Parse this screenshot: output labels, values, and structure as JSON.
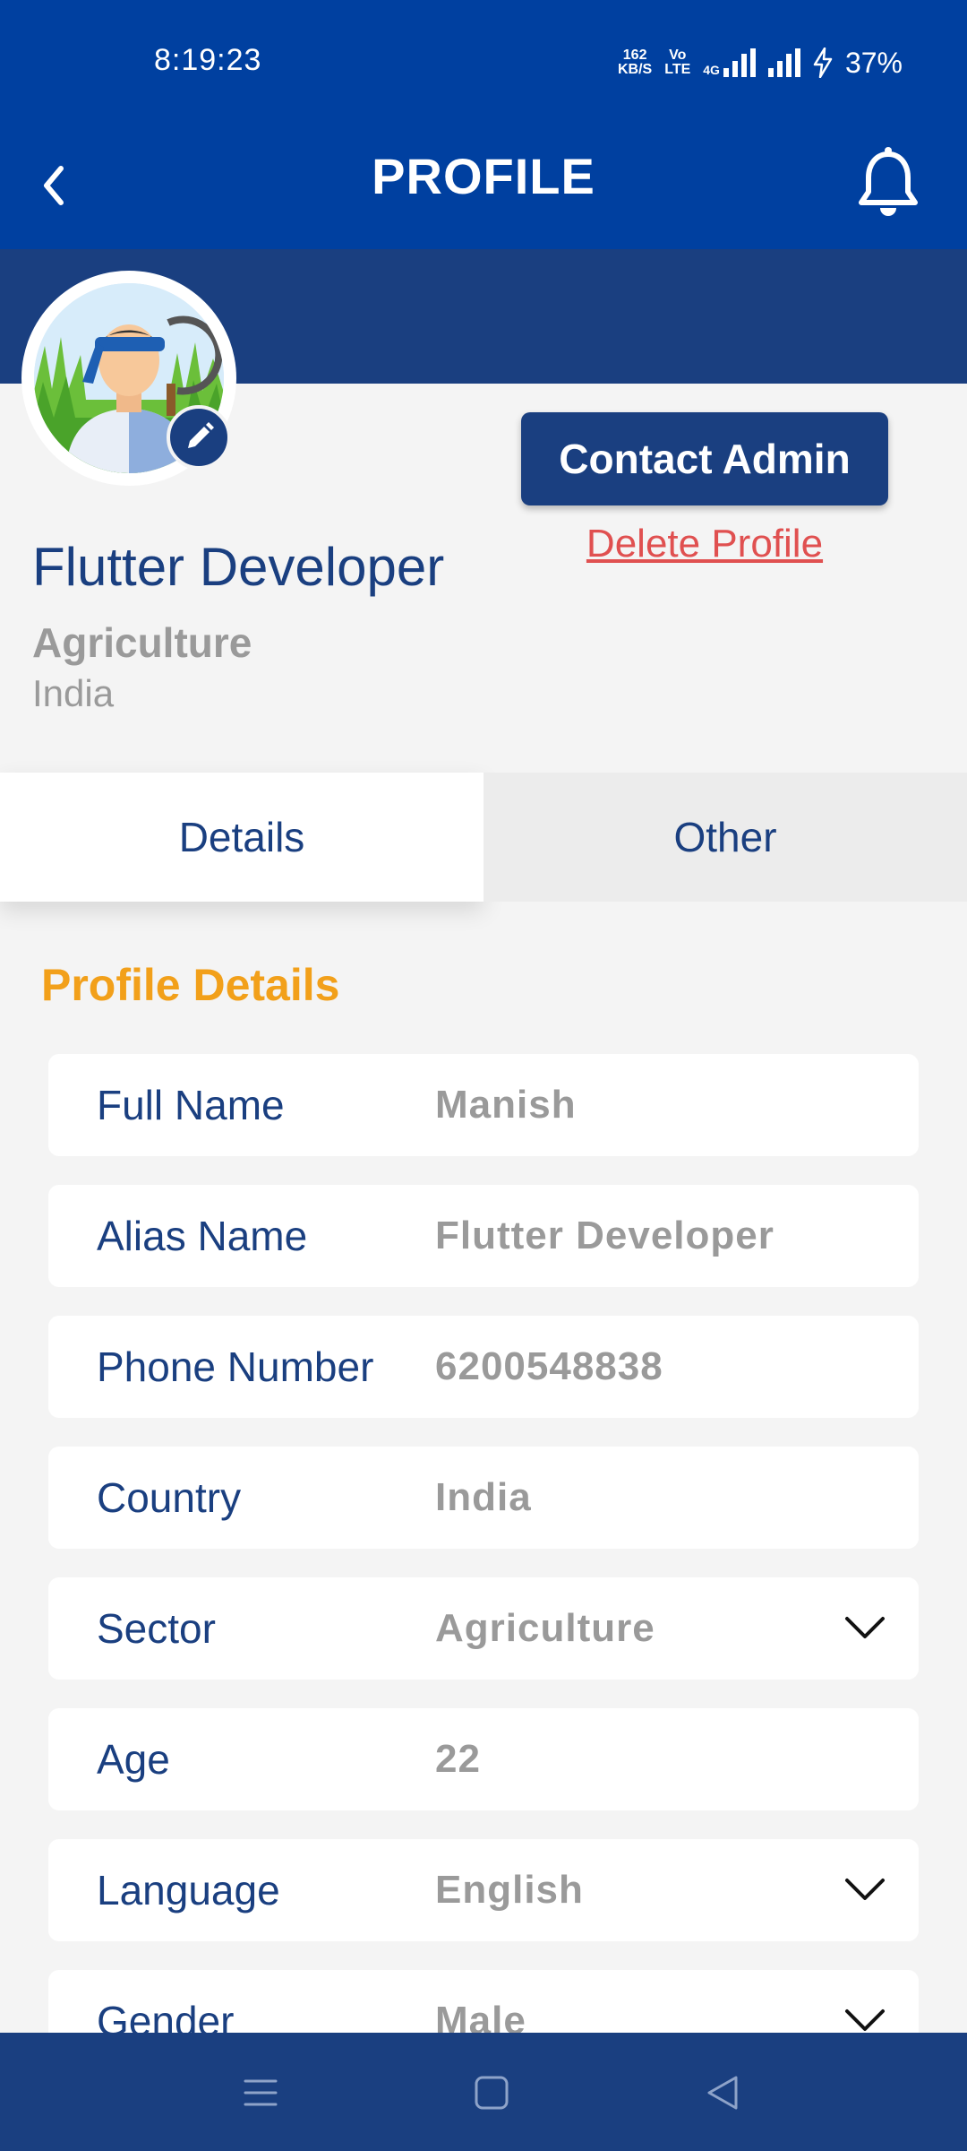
{
  "status_bar": {
    "time": "8:19:23",
    "speed_value": "162",
    "speed_unit": "KB/S",
    "volte_top": "Vo",
    "volte_bottom": "LTE",
    "network": "4G",
    "battery": "37%"
  },
  "app_bar": {
    "title": "PROFILE",
    "back_icon": "chevron-left-icon",
    "notification_icon": "bell-icon"
  },
  "profile": {
    "name": "Flutter Developer",
    "sector": "Agriculture",
    "country": "India",
    "edit_icon": "pencil-icon"
  },
  "actions": {
    "contact_admin": "Contact Admin",
    "delete_profile": "Delete Profile"
  },
  "tabs": [
    {
      "label": "Details",
      "active": true
    },
    {
      "label": "Other",
      "active": false
    }
  ],
  "section_title": "Profile Details",
  "fields": [
    {
      "label": "Full Name",
      "value": "Manish",
      "dropdown": false
    },
    {
      "label": "Alias Name",
      "value": "Flutter Developer",
      "dropdown": false
    },
    {
      "label": "Phone Number",
      "value": "6200548838",
      "dropdown": false
    },
    {
      "label": "Country",
      "value": "India",
      "dropdown": false
    },
    {
      "label": "Sector",
      "value": "Agriculture",
      "dropdown": true
    },
    {
      "label": "Age",
      "value": "22",
      "dropdown": false
    },
    {
      "label": "Language",
      "value": "English",
      "dropdown": true
    },
    {
      "label": "Gender",
      "value": "Male",
      "dropdown": true
    }
  ],
  "colors": {
    "primary": "#0040a0",
    "navy": "#1a3f80",
    "accent": "#f2a01a",
    "danger": "#e05050"
  },
  "nav": [
    "menu-icon",
    "home-square-icon",
    "back-triangle-icon"
  ]
}
